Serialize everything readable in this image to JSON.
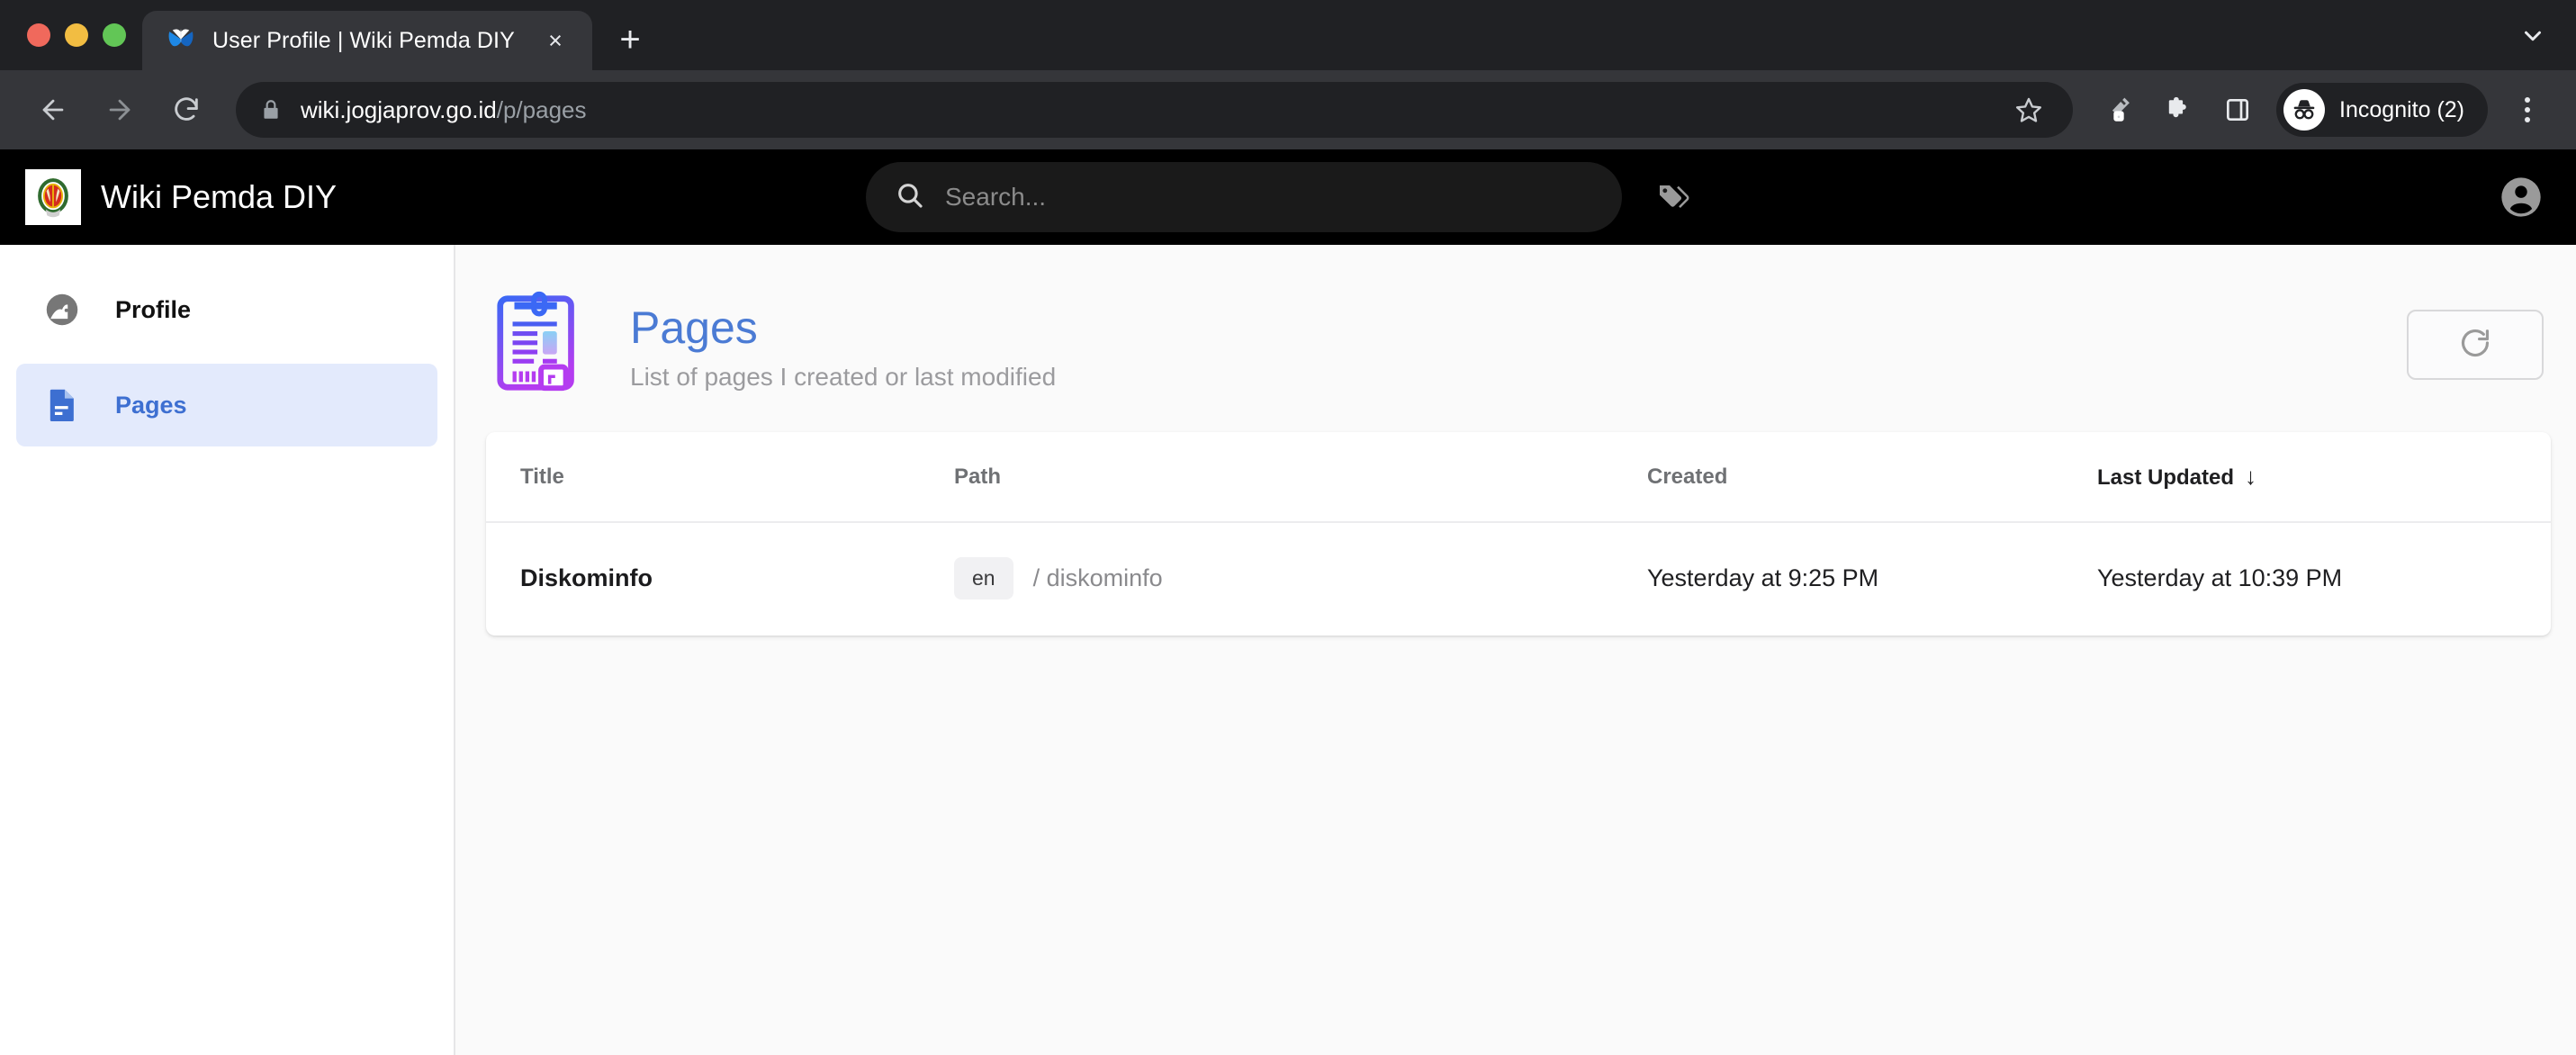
{
  "browser": {
    "tab": {
      "favicon": "butterfly-icon",
      "title": "User Profile | Wiki Pemda DIY",
      "close_label": "×"
    },
    "new_tab_label": "+",
    "toolbar": {
      "back_icon": "back-arrow-icon",
      "forward_icon": "forward-arrow-icon",
      "reload_icon": "reload-icon",
      "lock_icon": "lock-icon",
      "url_host": "wiki.jogjaprov.go.id",
      "url_path": "/p/pages",
      "star_icon": "star-icon",
      "pen_icon": "pen-marker-icon",
      "extensions_icon": "puzzle-icon",
      "side_panel_icon": "side-panel-icon",
      "incognito_label": "Incognito (2)",
      "menu_icon": "kebab-menu-icon"
    },
    "tab_search_icon": "chevron-down-icon"
  },
  "app": {
    "brand": {
      "logo": "diy-emblem-logo",
      "name": "Wiki Pemda DIY"
    },
    "search": {
      "icon": "search-icon",
      "placeholder": "Search..."
    },
    "tags_icon": "tags-icon",
    "account_icon": "account-circle-icon"
  },
  "sidebar": {
    "items": [
      {
        "label": "Profile",
        "icon": "profile-avatar-icon",
        "active": false
      },
      {
        "label": "Pages",
        "icon": "document-icon",
        "active": true
      }
    ]
  },
  "main": {
    "icon": "clipboard-pages-icon",
    "title": "Pages",
    "subtitle": "List of pages I created or last modified",
    "refresh_icon": "refresh-icon",
    "table": {
      "columns": [
        {
          "label": "Title",
          "sorted": false
        },
        {
          "label": "Path",
          "sorted": false
        },
        {
          "label": "Created",
          "sorted": false
        },
        {
          "label": "Last Updated",
          "sorted": true,
          "sort_arrow": "↓"
        }
      ],
      "rows": [
        {
          "title": "Diskominfo",
          "locale": "en",
          "path": "/ diskominfo",
          "created": "Yesterday at 9:25 PM",
          "updated": "Yesterday at 10:39 PM"
        }
      ]
    }
  },
  "colors": {
    "accent_blue": "#4b7bd4",
    "sidebar_active_bg": "#e3eafc",
    "appbar_bg": "#000000",
    "page_bg": "#fafafa"
  }
}
